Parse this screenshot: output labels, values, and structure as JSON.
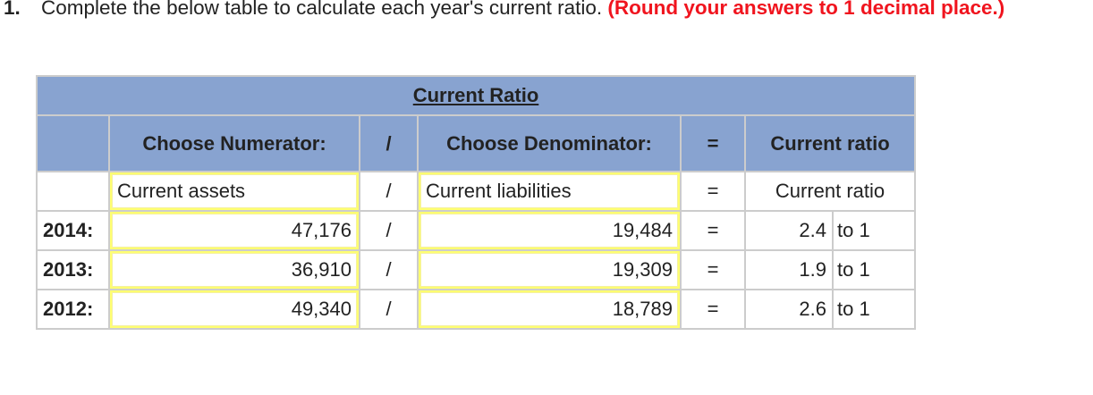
{
  "question": {
    "number": "1.",
    "text": "Complete the below table to calculate each year's current ratio.",
    "instruction": "(Round your answers to 1 decimal place.)"
  },
  "table": {
    "title": "Current Ratio",
    "headers": {
      "numerator": "Choose Numerator:",
      "divide": "/",
      "denominator": "Choose Denominator:",
      "equals": "=",
      "result": "Current ratio"
    },
    "formula_row": {
      "numerator": "Current assets",
      "divide": "/",
      "denominator": "Current liabilities",
      "equals": "=",
      "result": "Current ratio"
    },
    "rows": [
      {
        "year": "2014:",
        "numerator": "47,176",
        "divide": "/",
        "denominator": "19,484",
        "equals": "=",
        "ratio": "2.4",
        "suffix": "to 1"
      },
      {
        "year": "2013:",
        "numerator": "36,910",
        "divide": "/",
        "denominator": "19,309",
        "equals": "=",
        "ratio": "1.9",
        "suffix": "to 1"
      },
      {
        "year": "2012:",
        "numerator": "49,340",
        "divide": "/",
        "denominator": "18,789",
        "equals": "=",
        "ratio": "2.6",
        "suffix": "to 1"
      }
    ]
  }
}
